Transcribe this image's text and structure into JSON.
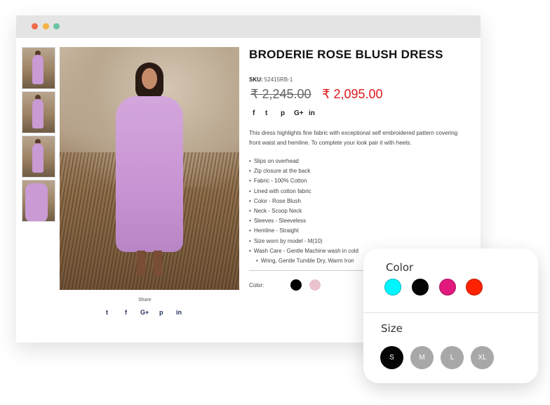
{
  "product": {
    "title": "BRODERIE ROSE BLUSH DRESS",
    "sku_label": "SKU:",
    "sku_value": "52415RB-1",
    "price_old": "₹ 2,245.00",
    "price_new": "₹ 2,095.00",
    "description": "This dress highlights fine fabric with exceptional self embroidered pattern covering front waist and hemline. To complete your look pair it with heels.",
    "details": [
      "Slips on overhead",
      "Zip closure at the back",
      "Fabric - 100% Cotton",
      "Lined with cotton fabric",
      "Color - Rose Blush",
      "Neck - Scoop Neck",
      "Sleeves - Sleeveless",
      "Hemline - Straight",
      "Size worn by model - M(10)",
      "Wash Care - Gentle Machine wash in cold",
      "Wring, Gentle Tumble Dry, Warm Iron"
    ],
    "color_label": "Color:",
    "colors": [
      "#000000",
      "#eac3cd"
    ]
  },
  "social": {
    "icons": [
      "f",
      "t",
      "p",
      "G+",
      "in"
    ]
  },
  "share": {
    "label": "Share",
    "icons": [
      "t",
      "f",
      "G+",
      "p",
      "in"
    ]
  },
  "options_panel": {
    "color_heading": "Color",
    "colors": [
      "#00f6ff",
      "#050505",
      "#e2197c",
      "#ff2200"
    ],
    "size_heading": "Size",
    "sizes": [
      "S",
      "M",
      "L",
      "XL"
    ],
    "selected_size": "S"
  }
}
